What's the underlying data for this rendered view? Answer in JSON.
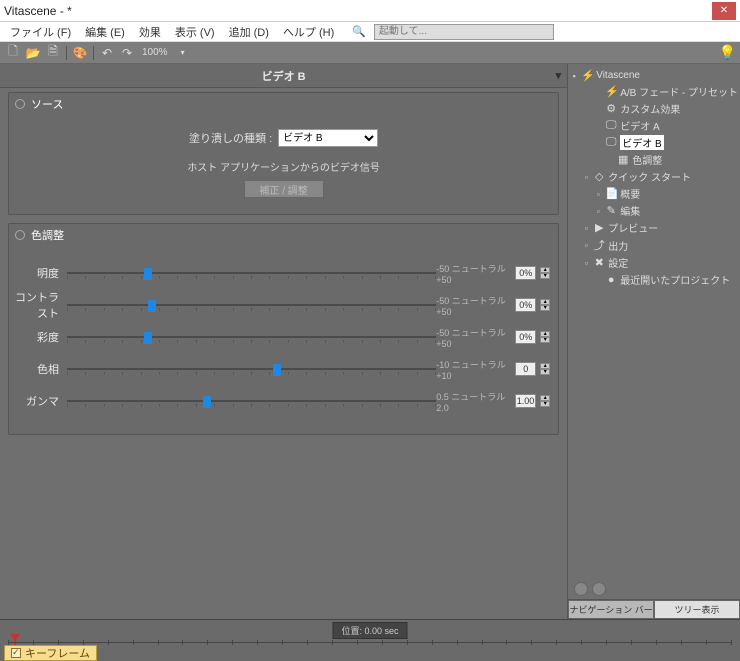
{
  "window": {
    "title": "Vitascene - *"
  },
  "menu": {
    "file": "ファイル (F)",
    "edit": "編集 (E)",
    "effect": "効果",
    "view": "表示 (V)",
    "add": "追加 (D)",
    "help": "ヘルプ (H)",
    "launch_ph": "起動して..."
  },
  "toolbar": {
    "zoom": "100%"
  },
  "header": {
    "video": "ビデオ B"
  },
  "source": {
    "title": "ソース",
    "fill_label": "塗り潰しの種類 :",
    "fill_value": "ビデオ B",
    "host_msg": "ホスト アプリケーションからのビデオ信号",
    "correct_btn": "補正 / 調整"
  },
  "color": {
    "title": "色調整",
    "rows": [
      {
        "label": "明度",
        "min": "-50",
        "mid": "ニュートラル",
        "max": "+50",
        "val": "0%",
        "pos": 22
      },
      {
        "label": "コントラスト",
        "min": "-50",
        "mid": "ニュートラル",
        "max": "+50",
        "val": "0%",
        "pos": 23
      },
      {
        "label": "彩度",
        "min": "-50",
        "mid": "ニュートラル",
        "max": "+50",
        "val": "0%",
        "pos": 22
      },
      {
        "label": "色相",
        "min": "-10",
        "mid": "ニュートラル",
        "max": "+10",
        "val": "0",
        "pos": 57
      },
      {
        "label": "ガンマ",
        "min": "0.5",
        "mid": "ニュートラル",
        "max": "2.0",
        "val": "1.00",
        "pos": 38
      }
    ]
  },
  "tree": {
    "root": "Vitascene",
    "items": [
      "A/B フェード - プリセット",
      "カスタム効果",
      "ビデオ A",
      "ビデオ B",
      "色調整",
      "クイック スタート",
      "概要",
      "編集",
      "プレビュー",
      "出力",
      "設定",
      "最近開いたプロジェクト"
    ]
  },
  "tabs": {
    "nav": "ナビゲーション バー",
    "tree": "ツリー表示"
  },
  "timeline": {
    "pos": "位置: 0.00 sec",
    "keyframe": "キーフレーム"
  }
}
